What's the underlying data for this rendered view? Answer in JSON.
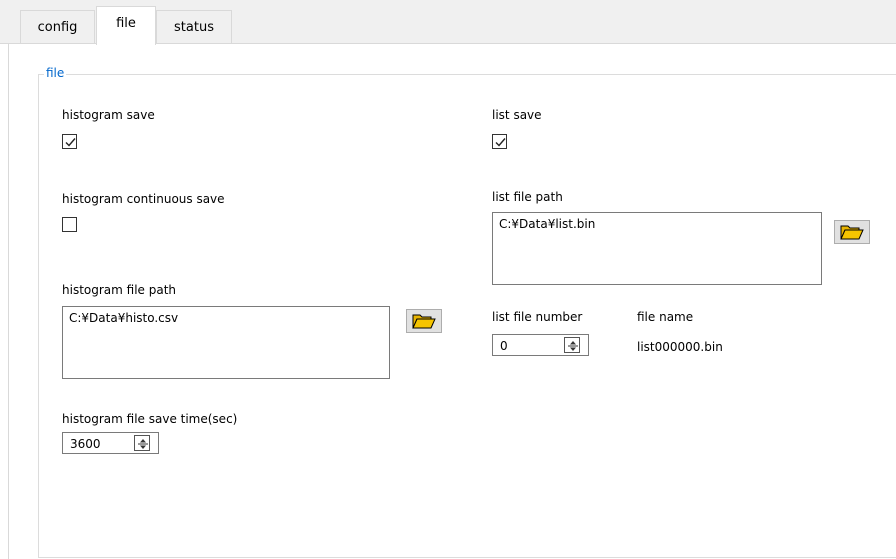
{
  "tabs": [
    {
      "label": "config",
      "active": false
    },
    {
      "label": "file",
      "active": true
    },
    {
      "label": "status",
      "active": false
    }
  ],
  "group": {
    "title": "file"
  },
  "histogram": {
    "save_label": "histogram save",
    "save_checked": true,
    "continuous_label": "histogram continuous save",
    "continuous_checked": false,
    "path_label": "histogram file path",
    "path_value": "C:¥Data¥histo.csv",
    "save_time_label": "histogram file save time(sec)",
    "save_time_value": "3600"
  },
  "list": {
    "save_label": "list save",
    "save_checked": true,
    "path_label": "list file path",
    "path_value": "C:¥Data¥list.bin",
    "number_label": "list file number",
    "number_value": "0",
    "filename_label": "file name",
    "filename_value": "list000000.bin"
  },
  "icons": {
    "browse": "folder-open-icon",
    "spin": "up-down-arrows-icon",
    "check": "checkmark-icon"
  },
  "colors": {
    "group_title": "#0066cc",
    "folder_fill": "#f5c400",
    "button_face": "#e1e1e1"
  }
}
